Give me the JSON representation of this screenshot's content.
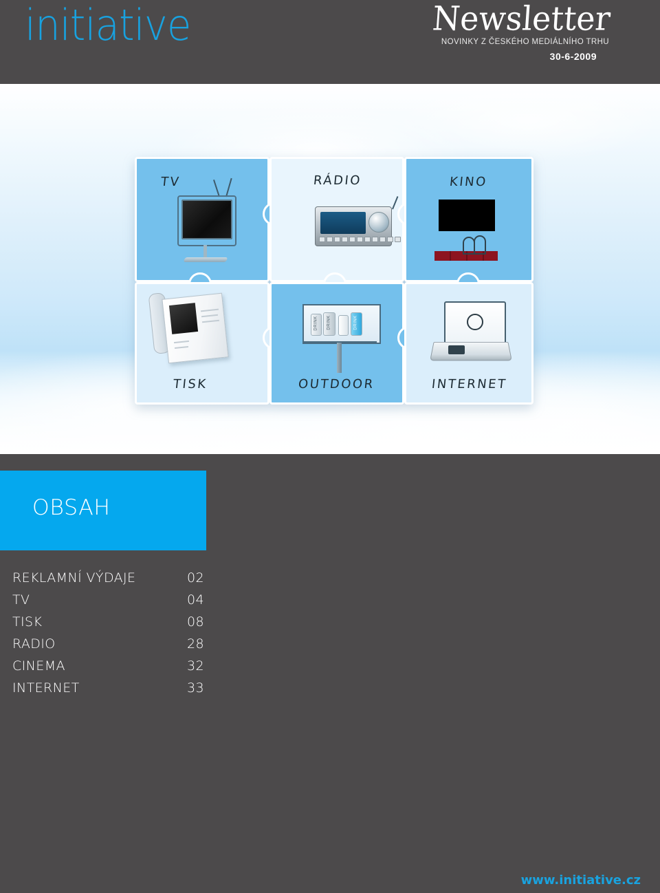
{
  "header": {
    "logo_text": "initiative",
    "logo_color": "#18a2e0",
    "newsletter_title": "Newsletter",
    "newsletter_subtitle": "NOVINKY Z ČESKÉHO MEDIÁLNÍHO TRHU",
    "date": "30-6-2009",
    "background_color": "#4c4a4b"
  },
  "hero": {
    "puzzle_pieces": [
      {
        "label": "TV",
        "icon": "television-icon"
      },
      {
        "label": "RÁDIO",
        "icon": "car-radio-icon"
      },
      {
        "label": "KINO",
        "icon": "cinema-screen-icon"
      },
      {
        "label": "TISK",
        "icon": "magazine-icon"
      },
      {
        "label": "OUTDOOR",
        "icon": "billboard-icon"
      },
      {
        "label": "INTERNET",
        "icon": "laptop-icon"
      }
    ]
  },
  "contents": {
    "heading": "OBSAH",
    "heading_background": "#05a8ee",
    "items": [
      {
        "label": "REKLAMNÍ VÝDAJE",
        "page": "02"
      },
      {
        "label": "TV",
        "page": "04"
      },
      {
        "label": "TISK",
        "page": "08"
      },
      {
        "label": "RADIO",
        "page": "28"
      },
      {
        "label": "CINEMA",
        "page": "32"
      },
      {
        "label": "INTERNET",
        "page": "33"
      }
    ]
  },
  "footer": {
    "url": "www.initiative.cz",
    "url_color": "#19a3e0"
  }
}
